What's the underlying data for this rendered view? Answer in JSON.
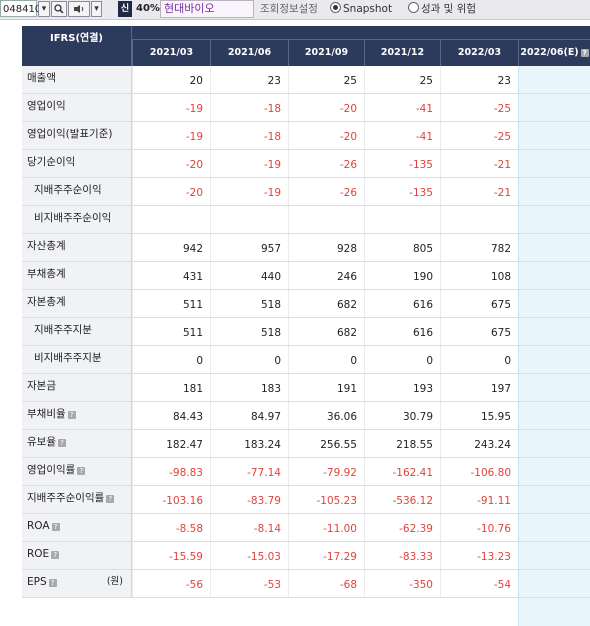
{
  "toolbar": {
    "stock_code": "048410",
    "zoom": "40%",
    "company_name": "현대바이오",
    "options_label": "조회정보설정",
    "option_snapshot": "Snapshot",
    "option_performance": "성과 및 위험",
    "badge": "신",
    "help": "?",
    "snapshot_selected": true
  },
  "table": {
    "basis_label": "IFRS(연결)",
    "periods": [
      "2021/03",
      "2021/06",
      "2021/09",
      "2021/12",
      "2022/03",
      "2022/06(E)"
    ],
    "rows": [
      {
        "label": "매출액",
        "indent": false,
        "help": false,
        "unit": "",
        "values": [
          "20",
          "23",
          "25",
          "25",
          "23"
        ]
      },
      {
        "label": "영업이익",
        "indent": false,
        "help": false,
        "unit": "",
        "values": [
          "-19",
          "-18",
          "-20",
          "-41",
          "-25"
        ]
      },
      {
        "label": "영업이익(발표기준)",
        "indent": false,
        "help": false,
        "unit": "",
        "values": [
          "-19",
          "-18",
          "-20",
          "-41",
          "-25"
        ]
      },
      {
        "label": "당기순이익",
        "indent": false,
        "help": false,
        "unit": "",
        "values": [
          "-20",
          "-19",
          "-26",
          "-135",
          "-21"
        ]
      },
      {
        "label": "지배주주순이익",
        "indent": true,
        "help": false,
        "unit": "",
        "values": [
          "-20",
          "-19",
          "-26",
          "-135",
          "-21"
        ]
      },
      {
        "label": "비지배주주순이익",
        "indent": true,
        "help": false,
        "unit": "",
        "values": [
          "",
          "",
          "",
          "",
          ""
        ]
      },
      {
        "label": "자산총계",
        "indent": false,
        "help": false,
        "unit": "",
        "values": [
          "942",
          "957",
          "928",
          "805",
          "782"
        ]
      },
      {
        "label": "부채총계",
        "indent": false,
        "help": false,
        "unit": "",
        "values": [
          "431",
          "440",
          "246",
          "190",
          "108"
        ]
      },
      {
        "label": "자본총계",
        "indent": false,
        "help": false,
        "unit": "",
        "values": [
          "511",
          "518",
          "682",
          "616",
          "675"
        ]
      },
      {
        "label": "지배주주지분",
        "indent": true,
        "help": false,
        "unit": "",
        "values": [
          "511",
          "518",
          "682",
          "616",
          "675"
        ]
      },
      {
        "label": "비지배주주지분",
        "indent": true,
        "help": false,
        "unit": "",
        "values": [
          "0",
          "0",
          "0",
          "0",
          "0"
        ]
      },
      {
        "label": "자본금",
        "indent": false,
        "help": false,
        "unit": "",
        "values": [
          "181",
          "183",
          "191",
          "193",
          "197"
        ]
      },
      {
        "label": "부채비율",
        "indent": false,
        "help": true,
        "unit": "",
        "values": [
          "84.43",
          "84.97",
          "36.06",
          "30.79",
          "15.95"
        ]
      },
      {
        "label": "유보율",
        "indent": false,
        "help": true,
        "unit": "",
        "values": [
          "182.47",
          "183.24",
          "256.55",
          "218.55",
          "243.24"
        ]
      },
      {
        "label": "영업이익률",
        "indent": false,
        "help": true,
        "unit": "",
        "values": [
          "-98.83",
          "-77.14",
          "-79.92",
          "-162.41",
          "-106.80"
        ]
      },
      {
        "label": "지배주주순이익률",
        "indent": false,
        "help": true,
        "unit": "",
        "values": [
          "-103.16",
          "-83.79",
          "-105.23",
          "-536.12",
          "-91.11"
        ]
      },
      {
        "label": "ROA",
        "indent": false,
        "help": true,
        "unit": "",
        "values": [
          "-8.58",
          "-8.14",
          "-11.00",
          "-62.39",
          "-10.76"
        ]
      },
      {
        "label": "ROE",
        "indent": false,
        "help": true,
        "unit": "",
        "values": [
          "-15.59",
          "-15.03",
          "-17.29",
          "-83.33",
          "-13.23"
        ]
      },
      {
        "label": "EPS",
        "indent": false,
        "help": true,
        "unit": "(원)",
        "values": [
          "-56",
          "-53",
          "-68",
          "-350",
          "-54"
        ]
      }
    ]
  },
  "colors": {
    "header_bg": "#2c3a5c",
    "negative": "#e0433b",
    "estimate_bg": "#e8f5fc"
  }
}
